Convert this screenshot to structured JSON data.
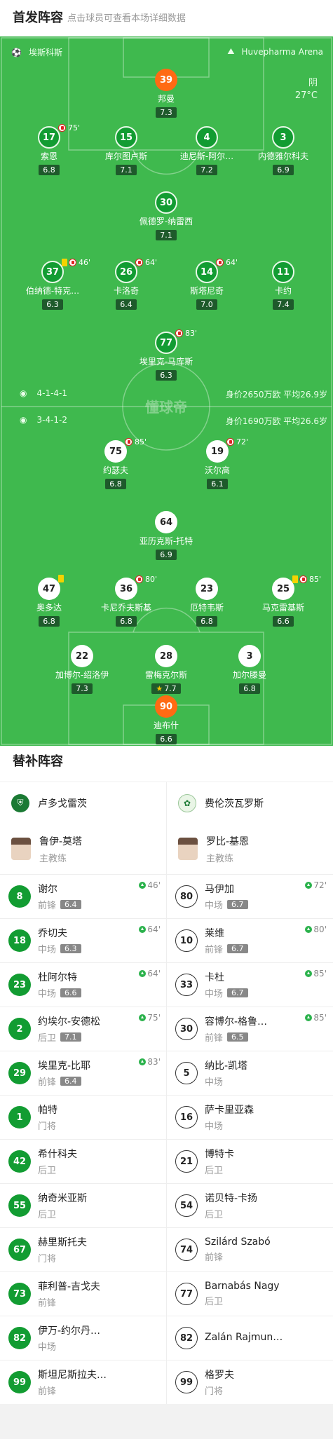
{
  "header": {
    "title": "首发阵容",
    "subtitle": "点击球员可查看本场详细数据"
  },
  "match": {
    "home_team": "埃斯科斯",
    "venue": "Huvepharma Arena",
    "weather": "阴",
    "temp": "27°C",
    "watermark": "懂球帝"
  },
  "home": {
    "formation": "4-1-4-1",
    "value": "身价2650万欧 平均26.9岁"
  },
  "away": {
    "formation": "3-4-1-2",
    "value": "身价1690万欧 平均26.6岁"
  },
  "home_players": [
    {
      "num": "39",
      "name": "邦曼",
      "rating": "7.3",
      "event": ""
    },
    {
      "num": "17",
      "name": "索恩",
      "rating": "6.8",
      "event": "75'"
    },
    {
      "num": "15",
      "name": "库尔图卢斯",
      "rating": "7.1",
      "event": ""
    },
    {
      "num": "4",
      "name": "迪尼斯-阿尔…",
      "rating": "7.2",
      "event": ""
    },
    {
      "num": "3",
      "name": "内德雅尔科夫",
      "rating": "6.9",
      "event": ""
    },
    {
      "num": "30",
      "name": "佩德罗-纳雷西",
      "rating": "7.1",
      "event": ""
    },
    {
      "num": "37",
      "name": "伯纳德-特克…",
      "rating": "6.3",
      "event": "46'"
    },
    {
      "num": "26",
      "name": "卡洛奇",
      "rating": "6.4",
      "event": "64'"
    },
    {
      "num": "14",
      "name": "斯塔尼奇",
      "rating": "7.0",
      "event": "64'"
    },
    {
      "num": "11",
      "name": "卡约",
      "rating": "7.4",
      "event": ""
    },
    {
      "num": "77",
      "name": "埃里克-马库斯",
      "rating": "6.3",
      "event": "83'"
    }
  ],
  "away_players": [
    {
      "num": "75",
      "name": "约瑟夫",
      "rating": "6.8",
      "event": "85'"
    },
    {
      "num": "19",
      "name": "沃尔高",
      "rating": "6.1",
      "event": "72'"
    },
    {
      "num": "64",
      "name": "亚历克斯-托特",
      "rating": "6.9",
      "event": ""
    },
    {
      "num": "47",
      "name": "奥多达",
      "rating": "6.8",
      "event": ""
    },
    {
      "num": "36",
      "name": "卡尼乔夫斯基",
      "rating": "6.8",
      "event": "80'"
    },
    {
      "num": "23",
      "name": "厄特韦斯",
      "rating": "6.8",
      "event": ""
    },
    {
      "num": "25",
      "name": "马克雷基斯",
      "rating": "6.6",
      "event": "85'"
    },
    {
      "num": "22",
      "name": "加博尔-绍洛伊",
      "rating": "7.3",
      "event": ""
    },
    {
      "num": "28",
      "name": "雷梅克尔斯",
      "rating": "7.7",
      "event": ""
    },
    {
      "num": "3",
      "name": "加尔滕曼",
      "rating": "6.8",
      "event": ""
    },
    {
      "num": "90",
      "name": "迪布什",
      "rating": "6.6",
      "event": ""
    }
  ],
  "subs": {
    "title": "替补阵容",
    "home_team": "卢多戈雷茨",
    "away_team": "费伦茨瓦罗斯",
    "home_coach": "鲁伊-莫塔",
    "away_coach": "罗比-基恩",
    "coach_role": "主教练",
    "rows": [
      {
        "h": {
          "num": "8",
          "name": "谢尔",
          "pos": "前锋",
          "rating": "6.4",
          "in": "46'"
        },
        "a": {
          "num": "80",
          "name": "马伊加",
          "pos": "中场",
          "rating": "6.7",
          "in": "72'"
        }
      },
      {
        "h": {
          "num": "18",
          "name": "乔切夫",
          "pos": "中场",
          "rating": "6.3",
          "in": "64'"
        },
        "a": {
          "num": "10",
          "name": "莱维",
          "pos": "前锋",
          "rating": "6.7",
          "in": "80'"
        }
      },
      {
        "h": {
          "num": "23",
          "name": "杜阿尔特",
          "pos": "中场",
          "rating": "6.6",
          "in": "64'"
        },
        "a": {
          "num": "33",
          "name": "卡杜",
          "pos": "中场",
          "rating": "6.7",
          "in": "85'"
        }
      },
      {
        "h": {
          "num": "2",
          "name": "约埃尔-安德松",
          "pos": "后卫",
          "rating": "7.1",
          "in": "75'"
        },
        "a": {
          "num": "30",
          "name": "容博尔-格鲁…",
          "pos": "前锋",
          "rating": "6.5",
          "in": "85'"
        }
      },
      {
        "h": {
          "num": "29",
          "name": "埃里克-比耶",
          "pos": "前锋",
          "rating": "6.4",
          "in": "83'"
        },
        "a": {
          "num": "5",
          "name": "纳比-凯塔",
          "pos": "中场",
          "rating": "",
          "in": ""
        }
      },
      {
        "h": {
          "num": "1",
          "name": "帕特",
          "pos": "门将",
          "rating": "",
          "in": ""
        },
        "a": {
          "num": "16",
          "name": "萨卡里亚森",
          "pos": "中场",
          "rating": "",
          "in": ""
        }
      },
      {
        "h": {
          "num": "42",
          "name": "希什科夫",
          "pos": "后卫",
          "rating": "",
          "in": ""
        },
        "a": {
          "num": "21",
          "name": "博特卡",
          "pos": "后卫",
          "rating": "",
          "in": ""
        }
      },
      {
        "h": {
          "num": "55",
          "name": "纳奇米亚斯",
          "pos": "后卫",
          "rating": "",
          "in": ""
        },
        "a": {
          "num": "54",
          "name": "诺贝特-卡扬",
          "pos": "后卫",
          "rating": "",
          "in": ""
        }
      },
      {
        "h": {
          "num": "67",
          "name": "赫里斯托夫",
          "pos": "门将",
          "rating": "",
          "in": ""
        },
        "a": {
          "num": "74",
          "name": "Szilárd Szabó",
          "pos": "前锋",
          "rating": "",
          "in": ""
        }
      },
      {
        "h": {
          "num": "73",
          "name": "菲利普-吉戈夫",
          "pos": "前锋",
          "rating": "",
          "in": ""
        },
        "a": {
          "num": "77",
          "name": "Barnabás Nagy",
          "pos": "后卫",
          "rating": "",
          "in": ""
        }
      },
      {
        "h": {
          "num": "82",
          "name": "伊万-约尔丹…",
          "pos": "中场",
          "rating": "",
          "in": ""
        },
        "a": {
          "num": "82",
          "name": "Zalán Rajmun…",
          "pos": "",
          "rating": "",
          "in": ""
        }
      },
      {
        "h": {
          "num": "99",
          "name": "斯坦尼斯拉夫…",
          "pos": "前锋",
          "rating": "",
          "in": ""
        },
        "a": {
          "num": "99",
          "name": "格罗夫",
          "pos": "门将",
          "rating": "",
          "in": ""
        }
      }
    ]
  }
}
